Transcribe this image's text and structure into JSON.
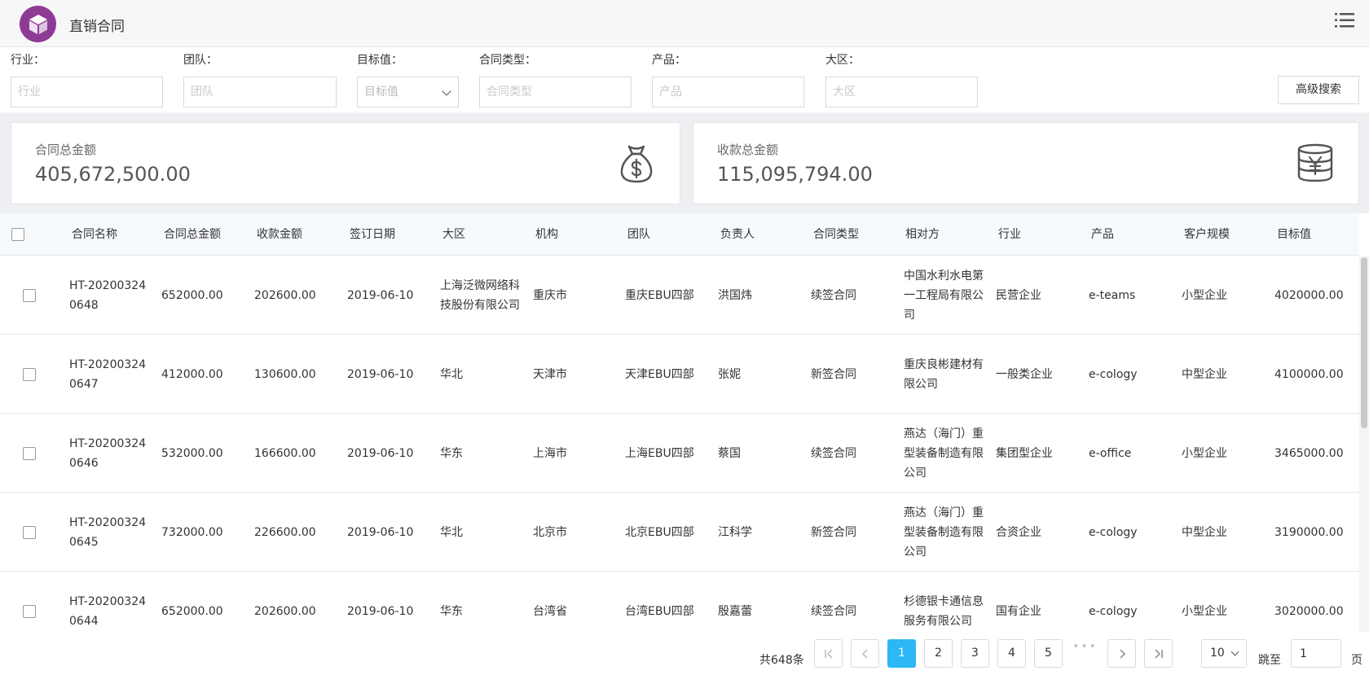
{
  "app": {
    "title": "直销合同"
  },
  "filters": [
    {
      "label": "行业：",
      "placeholder": "行业"
    },
    {
      "label": "团队：",
      "placeholder": "团队"
    },
    {
      "label": "目标值：",
      "placeholder": "目标值"
    },
    {
      "label": "合同类型：",
      "placeholder": "合同类型"
    },
    {
      "label": "产品：",
      "placeholder": "产品"
    },
    {
      "label": "大区：",
      "placeholder": "大区"
    }
  ],
  "advanced_search_label": "高级搜索",
  "summary": {
    "contract_total": {
      "label": "合同总金额",
      "value": "405,672,500.00"
    },
    "payment_total": {
      "label": "收款总金额",
      "value": "115,095,794.00"
    }
  },
  "table": {
    "columns": [
      "合同名称",
      "合同总金额",
      "收款金额",
      "签订日期",
      "大区",
      "机构",
      "团队",
      "负责人",
      "合同类型",
      "相对方",
      "行业",
      "产品",
      "客户规模",
      "目标值"
    ],
    "rows": [
      [
        "HT-202003240648",
        "652000.00",
        "202600.00",
        "2019-06-10",
        "上海泛微网络科技股份有限公司",
        "重庆市",
        "重庆EBU四部",
        "洪国炜",
        "续签合同",
        "中国水利水电第一工程局有限公司",
        "民营企业",
        "e-teams",
        "小型企业",
        "4020000.00"
      ],
      [
        "HT-202003240647",
        "412000.00",
        "130600.00",
        "2019-06-10",
        "华北",
        "天津市",
        "天津EBU四部",
        "张妮",
        "新签合同",
        "重庆良彬建材有限公司",
        "一般类企业",
        "e-cology",
        "中型企业",
        "4100000.00"
      ],
      [
        "HT-202003240646",
        "532000.00",
        "166600.00",
        "2019-06-10",
        "华东",
        "上海市",
        "上海EBU四部",
        "蔡国",
        "续签合同",
        "燕达（海门）重型装备制造有限公司",
        "集团型企业",
        "e-office",
        "小型企业",
        "3465000.00"
      ],
      [
        "HT-202003240645",
        "732000.00",
        "226600.00",
        "2019-06-10",
        "华北",
        "北京市",
        "北京EBU四部",
        "江科学",
        "新签合同",
        "燕达（海门）重型装备制造有限公司",
        "合资企业",
        "e-cology",
        "中型企业",
        "3190000.00"
      ],
      [
        "HT-202003240644",
        "652000.00",
        "202600.00",
        "2019-06-10",
        "华东",
        "台湾省",
        "台湾EBU四部",
        "殷嘉蕾",
        "续签合同",
        "杉德银卡通信息服务有限公司",
        "国有企业",
        "e-cology",
        "小型企业",
        "3020000.00"
      ]
    ]
  },
  "pagination": {
    "total_text": "共648条",
    "pages": [
      "1",
      "2",
      "3",
      "4",
      "5"
    ],
    "current": "1",
    "ellipsis": "•••",
    "page_size": "10",
    "jump_label": "跳至",
    "jump_value": "1",
    "page_suffix": "页"
  },
  "colors": {
    "brand": "#8e3b96",
    "accent": "#2db7f5"
  }
}
